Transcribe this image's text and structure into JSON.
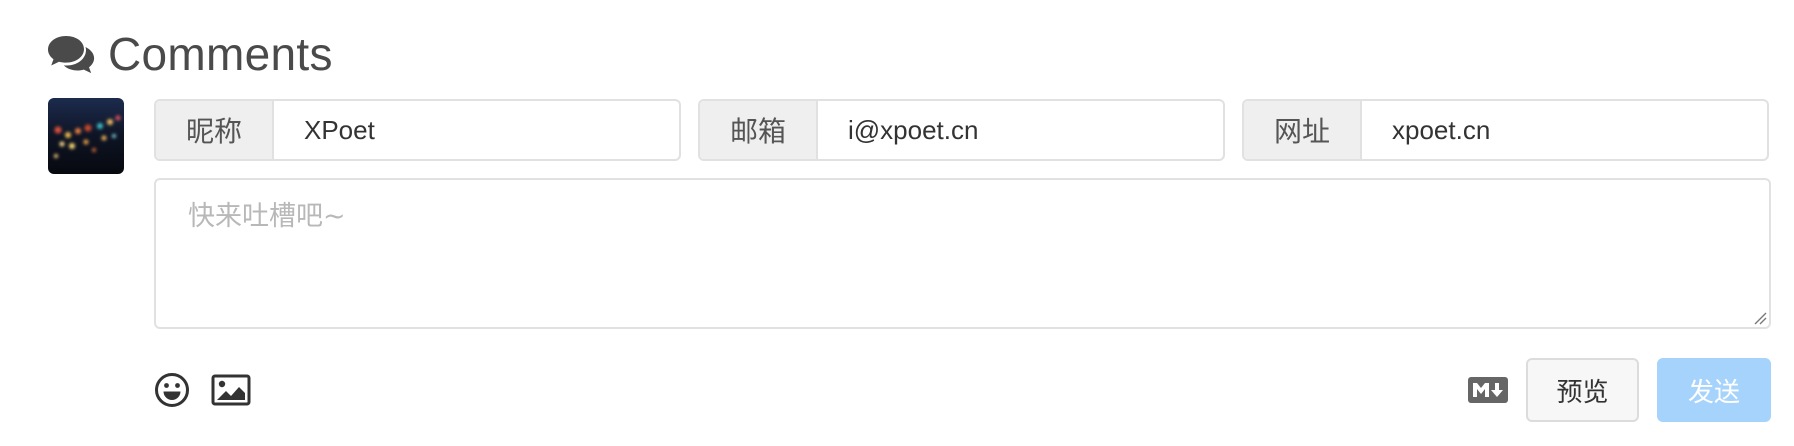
{
  "header": {
    "title": "Comments",
    "icon": "comments-icon"
  },
  "fields": {
    "nick": {
      "label": "昵称",
      "value": "XPoet",
      "placeholder": ""
    },
    "mail": {
      "label": "邮箱",
      "value": "i@xpoet.cn",
      "placeholder": ""
    },
    "link": {
      "label": "网址",
      "value": "xpoet.cn",
      "placeholder": ""
    }
  },
  "editor": {
    "placeholder": "快来吐槽吧~",
    "value": ""
  },
  "toolbar": {
    "emoji_icon": "smile-icon",
    "image_icon": "image-icon",
    "markdown_icon": "markdown-icon",
    "preview_label": "预览",
    "send_label": "发送"
  },
  "colors": {
    "send_disabled": "#a6d3fb",
    "label_bg": "#efefef",
    "border": "#e1e1e1"
  }
}
